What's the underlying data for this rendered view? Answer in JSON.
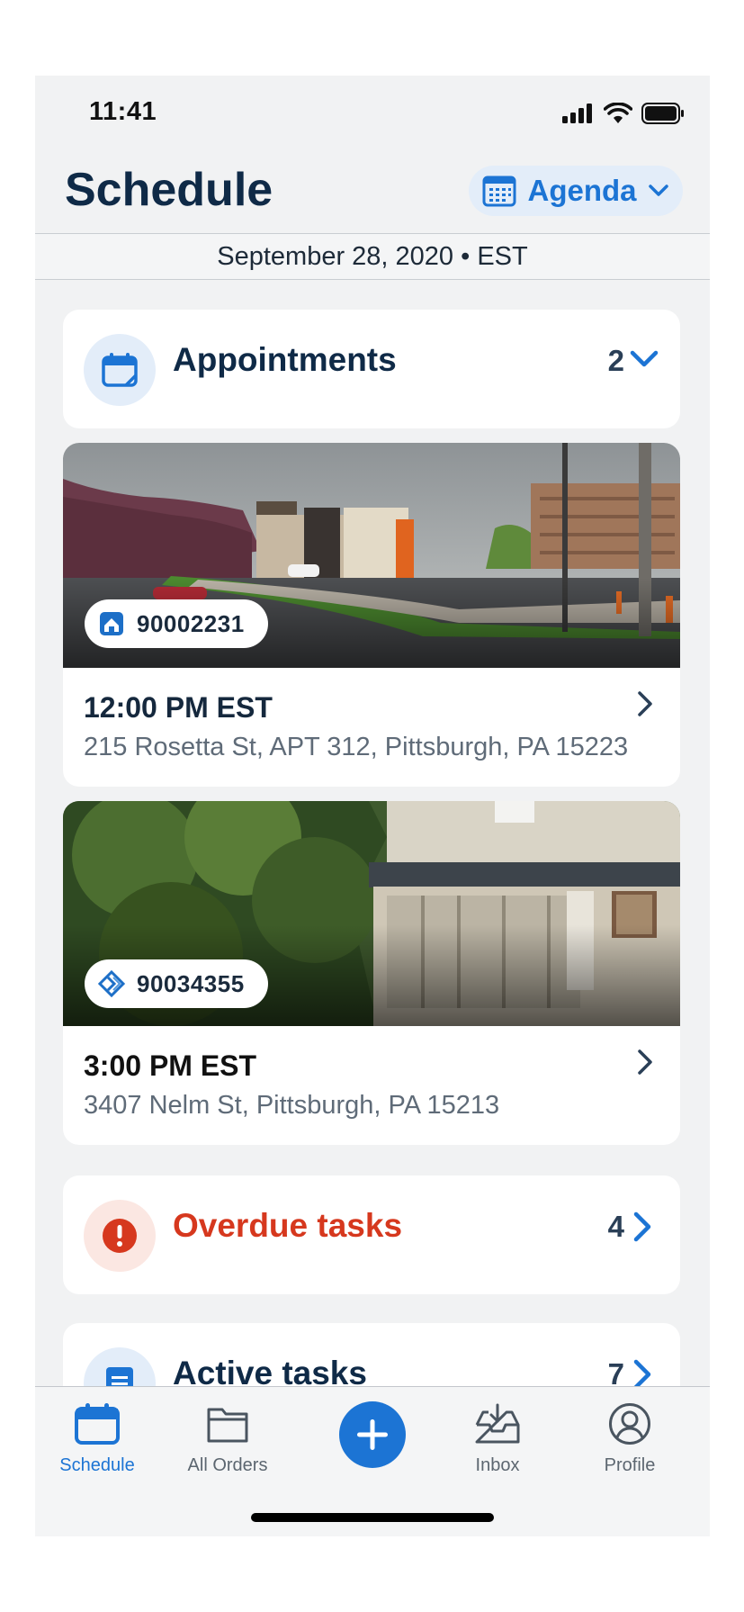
{
  "status_bar": {
    "time": "11:41"
  },
  "header": {
    "title": "Schedule",
    "view_selector_label": "Agenda"
  },
  "date_bar": {
    "text": "September 28, 2020 • EST"
  },
  "sections": {
    "appointments": {
      "title": "Appointments",
      "count": "2"
    },
    "overdue_tasks": {
      "title": "Overdue tasks",
      "count": "4"
    },
    "active_tasks": {
      "title": "Active tasks",
      "count": "7"
    }
  },
  "appointments": [
    {
      "order_id": "90002231",
      "time": "12:00 PM EST",
      "address": "215 Rosetta St, APT 312, Pittsburgh, PA 15223"
    },
    {
      "order_id": "90034355",
      "time": "3:00 PM EST",
      "address": "3407 Nelm St, Pittsburgh, PA 15213"
    }
  ],
  "tab_bar": {
    "items": [
      {
        "label": "Schedule",
        "icon": "calendar-icon",
        "active": true
      },
      {
        "label": "All Orders",
        "icon": "folder-icon",
        "active": false
      },
      {
        "label": "",
        "icon": "plus-icon",
        "active": false
      },
      {
        "label": "Inbox",
        "icon": "inbox-icon",
        "active": false
      },
      {
        "label": "Profile",
        "icon": "user-icon",
        "active": false
      }
    ]
  },
  "colors": {
    "brand_blue": "#1c74d4",
    "navy": "#0f2a47",
    "overdue_red": "#d6381e",
    "background": "#f1f2f3"
  }
}
